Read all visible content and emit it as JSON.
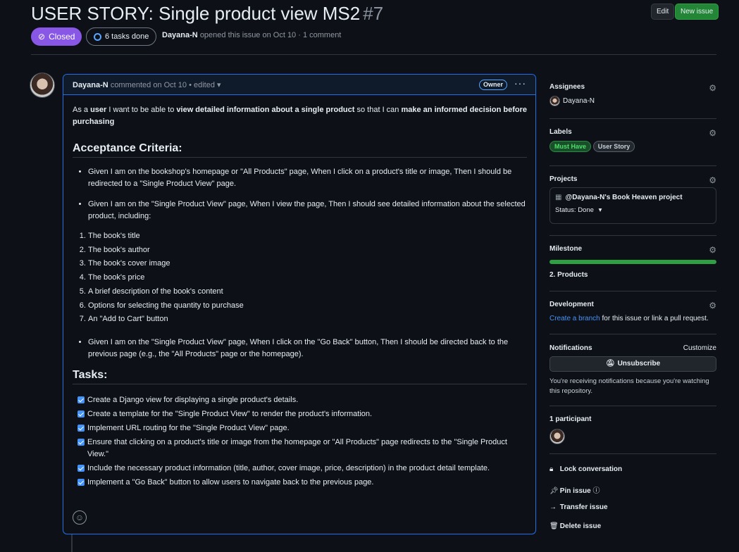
{
  "issue": {
    "title": "USER STORY: Single product view MS2",
    "number": "#7",
    "state": "Closed",
    "tasks_done": "6 tasks done",
    "author": "Dayana-N",
    "opened_text": "opened this issue on Oct 10 · 1 comment"
  },
  "header_buttons": {
    "edit": "Edit",
    "new_issue": "New issue"
  },
  "comment": {
    "author": "Dayana-N",
    "meta": "commented on Oct 10 • edited",
    "owner_badge": "Owner",
    "menu": "···",
    "story": {
      "p1": "As a ",
      "b1": "user",
      "p2": " I want to be able to ",
      "b2": "view detailed information about a single product",
      "p3": " so that I can ",
      "b3": "make an informed decision before purchasing"
    },
    "acceptance_heading": "Acceptance Criteria:",
    "criteria": [
      "Given I am on the bookshop's homepage or \"All Products\" page, When I click on a product's title or image, Then I should be redirected to a \"Single Product View\" page.",
      "Given I am on the \"Single Product View\" page, When I view the page, Then I should see detailed information about the selected product, including:"
    ],
    "details": [
      "The book's title",
      "The book's author",
      "The book's cover image",
      "The book's price",
      "A brief description of the book's content",
      "Options for selecting the quantity to purchase",
      "An \"Add to Cart\" button"
    ],
    "criteria_last": "Given I am on the \"Single Product View\" page, When I click on the \"Go Back\" button, Then I should be directed back to the previous page (e.g., the \"All Products\" page or the homepage).",
    "tasks_heading": "Tasks:",
    "tasks": [
      "Create a Django view for displaying a single product's details.",
      "Create a template for the \"Single Product View\" to render the product's information.",
      "Implement URL routing for the \"Single Product View\" page.",
      "Ensure that clicking on a product's title or image from the homepage or \"All Products\" page redirects to the \"Single Product View.\"",
      "Include the necessary product information (title, author, cover image, price, description) in the product detail template.",
      "Implement a \"Go Back\" button to allow users to navigate back to the previous page."
    ]
  },
  "sidebar": {
    "assignees_heading": "Assignees",
    "assignee": "Dayana-N",
    "labels_heading": "Labels",
    "labels": [
      "Must Have",
      "User Story"
    ],
    "projects_heading": "Projects",
    "project_name": "@Dayana-N's Book Heaven project",
    "project_status": "Status: Done",
    "milestone_heading": "Milestone",
    "milestone_progress": 1.0,
    "milestone_name": "2. Products",
    "development_heading": "Development",
    "development_link": "Create a branch",
    "development_text": " for this issue or link a pull request.",
    "notifications_heading": "Notifications",
    "customize": "Customize",
    "unsubscribe": "Unsubscribe",
    "notif_text": "You're receiving notifications because you're watching this repository.",
    "participants": "1 participant",
    "actions": [
      "Lock conversation",
      "Pin issue",
      "Transfer issue",
      "Delete issue"
    ]
  },
  "colors": {
    "closed": "#8957e5",
    "accent": "#1f6feb",
    "green": "#238636"
  }
}
